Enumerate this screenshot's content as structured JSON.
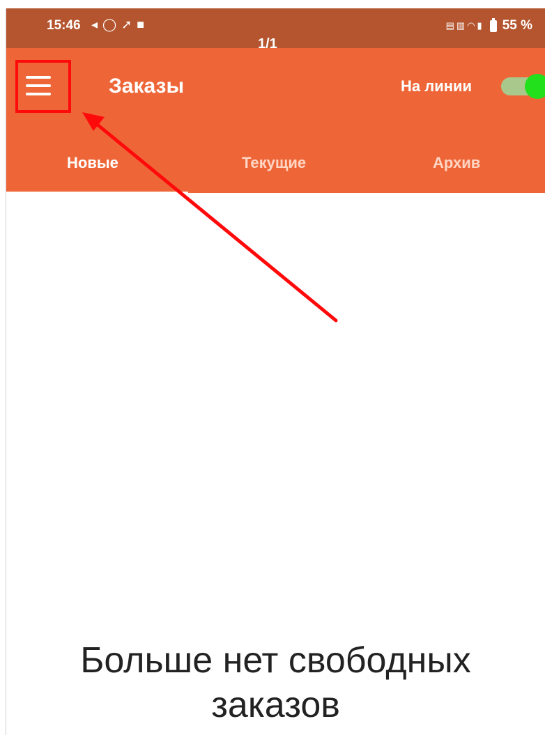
{
  "status_bar": {
    "time": "15:46",
    "left_icons": [
      "notification-icon",
      "whatsapp-icon",
      "location-icon",
      "video-icon"
    ],
    "right_icons": [
      "volte-icon",
      "network-speed-icon",
      "wifi-icon",
      "signal-icon",
      "battery-icon"
    ],
    "battery": "55 %"
  },
  "page_indicator": "1/1",
  "app_bar": {
    "title": "Заказы",
    "online_label": "На линии",
    "online_toggle_on": true
  },
  "tabs": [
    {
      "label": "Новые",
      "active": true
    },
    {
      "label": "Текущие",
      "active": false
    },
    {
      "label": "Архив",
      "active": false
    }
  ],
  "empty_state": {
    "line1": "Больше нет свободных",
    "line2": "заказов"
  },
  "colors": {
    "status_bar": "#b4552f",
    "app_bar": "#ee6638",
    "toggle_thumb": "#22e01c",
    "annotation": "#ff0a0a"
  }
}
